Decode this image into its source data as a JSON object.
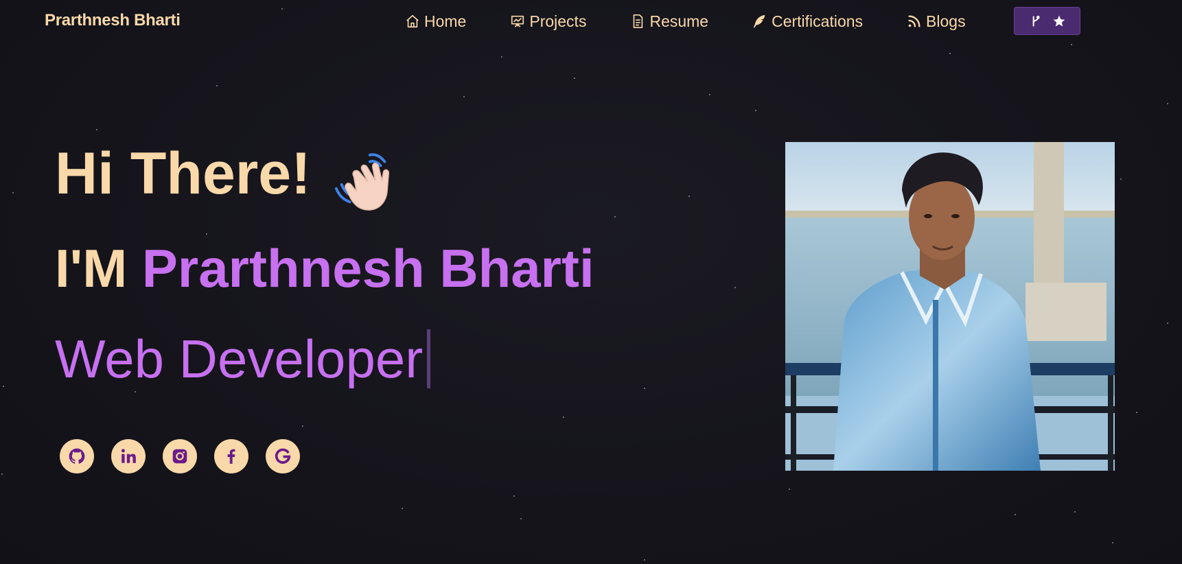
{
  "brand": "Prarthnesh Bharti",
  "nav": {
    "items": [
      {
        "label": "Home",
        "icon": "home-icon"
      },
      {
        "label": "Projects",
        "icon": "projects-icon"
      },
      {
        "label": "Resume",
        "icon": "resume-icon"
      },
      {
        "label": "Certifications",
        "icon": "certifications-icon"
      },
      {
        "label": "Blogs",
        "icon": "blogs-icon"
      }
    ],
    "fork_button_icons": [
      "git-fork-icon",
      "star-icon"
    ]
  },
  "hero": {
    "greeting": "Hi There!",
    "greeting_emoji": "waving-hand-icon",
    "intro_prefix": "I'M",
    "name": "Prarthnesh Bharti",
    "role": "Web Developer"
  },
  "socials": [
    {
      "name": "github-icon"
    },
    {
      "name": "linkedin-icon"
    },
    {
      "name": "instagram-icon"
    },
    {
      "name": "facebook-icon"
    },
    {
      "name": "google-icon"
    }
  ],
  "colors": {
    "background": "#15141b",
    "accent_peach": "#f9d8a9",
    "accent_purple": "#c770f0",
    "button_purple": "#4a2b6f"
  }
}
